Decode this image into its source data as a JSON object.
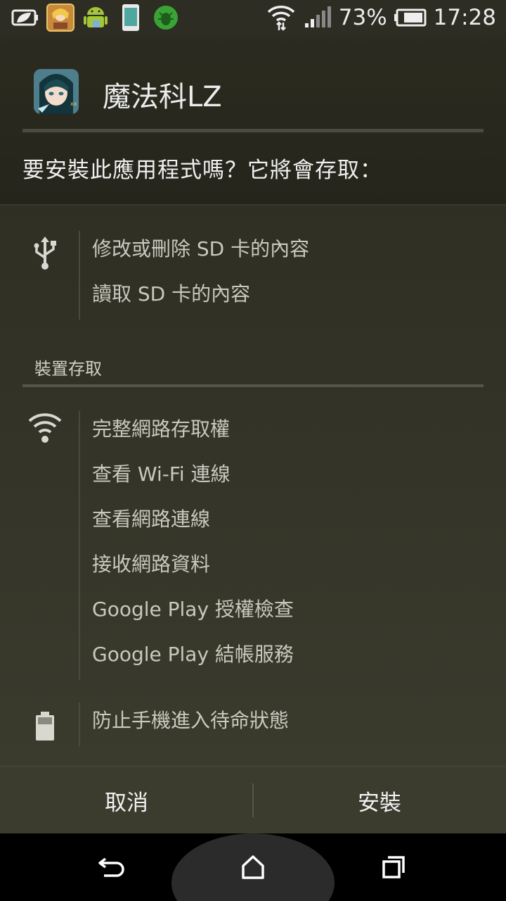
{
  "status_bar": {
    "battery_percent": "73%",
    "time": "17:28",
    "notification_icons": [
      "leaf-battery-icon",
      "game-app-icon",
      "android-icon",
      "phone-icon",
      "shield-bug-icon"
    ]
  },
  "app": {
    "name": "魔法科LZ"
  },
  "prompt": "要安裝此應用程式嗎？它將會存取：",
  "permission_groups": [
    {
      "icon": "usb-icon",
      "items": [
        "修改或刪除 SD 卡的內容",
        "讀取 SD 卡的內容"
      ]
    }
  ],
  "section": {
    "title": "裝置存取"
  },
  "device_groups": [
    {
      "icon": "wifi-icon",
      "items": [
        "完整網路存取權",
        "查看 Wi-Fi 連線",
        "查看網路連線",
        "接收網路資料",
        "Google Play 授權檢查",
        "Google Play 結帳服務"
      ]
    },
    {
      "icon": "battery-icon",
      "items": [
        "防止手機進入待命狀態"
      ]
    }
  ],
  "buttons": {
    "cancel": "取消",
    "install": "安裝"
  },
  "navigation": {
    "icons": [
      "back-icon",
      "home-icon",
      "recent-apps-icon"
    ]
  }
}
